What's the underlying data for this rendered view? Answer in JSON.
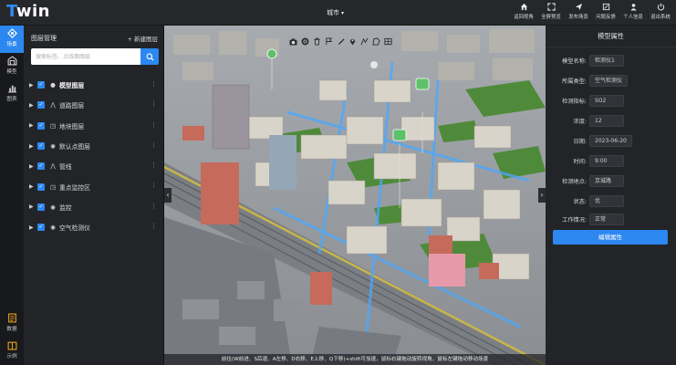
{
  "app": {
    "logo_first": "T",
    "logo_rest": "win"
  },
  "header": {
    "city_selector": "城市",
    "nav": [
      {
        "label": "返回视角",
        "icon": "home-icon"
      },
      {
        "label": "全屏预览",
        "icon": "fullscreen-icon"
      },
      {
        "label": "发布场景",
        "icon": "publish-icon"
      },
      {
        "label": "问题反馈",
        "icon": "feedback-icon"
      },
      {
        "label": "个人信息",
        "icon": "user-icon"
      },
      {
        "label": "退出系统",
        "icon": "logout-icon"
      }
    ]
  },
  "rail": {
    "top": [
      {
        "label": "场景",
        "icon": "scene-icon",
        "active": true
      },
      {
        "label": "模型",
        "icon": "model-icon",
        "active": false
      },
      {
        "label": "图表",
        "icon": "chart-icon",
        "active": false
      }
    ],
    "bottom": [
      {
        "label": "数据",
        "icon": "data-icon"
      },
      {
        "label": "示例",
        "icon": "example-icon"
      }
    ]
  },
  "layers": {
    "title": "图层管理",
    "new_layer": "+ 新建图层",
    "search_placeholder": "搜索标签、点线面图层",
    "items": [
      {
        "label": "模型图层",
        "icon": "layer-lock-icon",
        "bold": true
      },
      {
        "label": "道路图层",
        "icon": "line-icon",
        "bold": false
      },
      {
        "label": "地块图层",
        "icon": "polygon-icon",
        "bold": false
      },
      {
        "label": "默认点图层",
        "icon": "pin-icon",
        "bold": false
      },
      {
        "label": "管线",
        "icon": "line-icon",
        "bold": false
      },
      {
        "label": "重点监控区",
        "icon": "polygon-icon",
        "bold": false
      },
      {
        "label": "监控",
        "icon": "pin-icon",
        "bold": false
      },
      {
        "label": "空气检测仪",
        "icon": "pin-icon",
        "bold": false
      }
    ]
  },
  "viewport": {
    "toolbar": [
      "camera-icon",
      "settings-icon",
      "delete-icon",
      "flag-icon",
      "polygon-icon",
      "brush-icon",
      "pin-icon",
      "line-icon",
      "area-icon",
      "layers-icon"
    ],
    "hint": "前往(W前进、S后退、A左移、D右移、E上移、Q下移)+shift可加速，鼠标右键拖动旋转视角，鼠标左键拖动移动场景"
  },
  "props": {
    "title": "模型属性",
    "rows": [
      {
        "key": "模型名称:",
        "value": "检测仪1"
      },
      {
        "key": "所属类型:",
        "value": "空气检测仪"
      },
      {
        "key": "检测指标:",
        "value": "SO2"
      },
      {
        "key": "浓度:",
        "value": "12"
      },
      {
        "key": "日期:",
        "value": "2023-06-20"
      },
      {
        "key": "时间:",
        "value": "9:00"
      },
      {
        "key": "检测地点:",
        "value": "京城路"
      },
      {
        "key": "状态:",
        "value": "优"
      },
      {
        "key": "工作情况:",
        "value": "正常"
      }
    ],
    "edit_button": "编辑属性"
  },
  "colors": {
    "accent": "#2c88f0",
    "panel": "#222428",
    "rail": "#18191c",
    "rail_bottom_icon": "#e7a21a"
  }
}
